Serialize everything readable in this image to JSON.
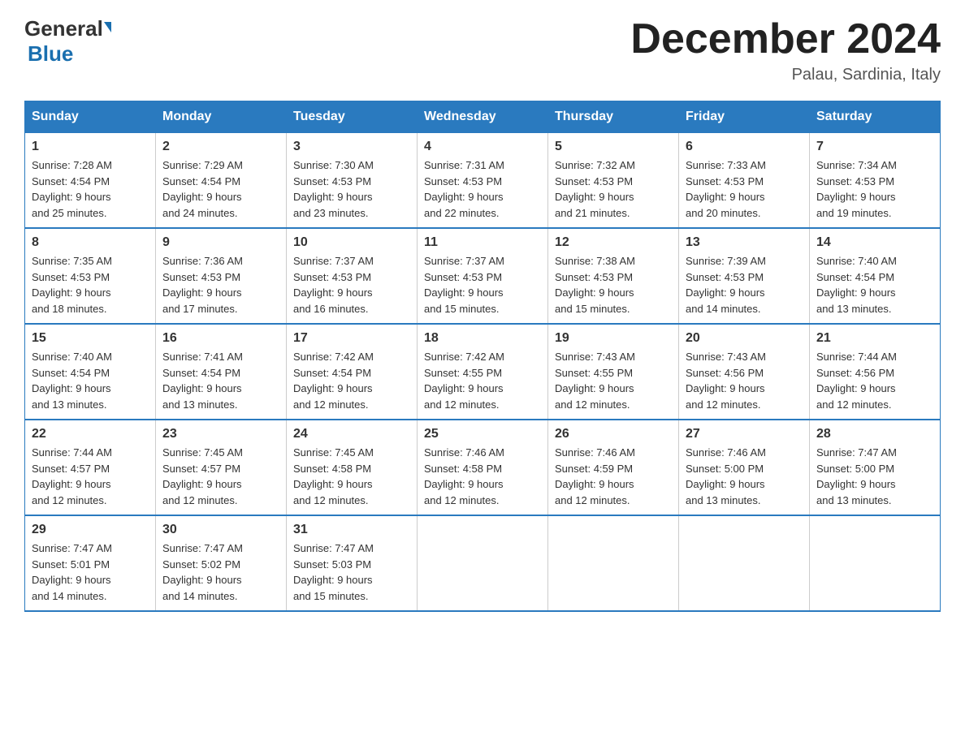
{
  "logo": {
    "general": "General",
    "triangle": "",
    "blue": "Blue"
  },
  "header": {
    "title": "December 2024",
    "location": "Palau, Sardinia, Italy"
  },
  "weekdays": [
    "Sunday",
    "Monday",
    "Tuesday",
    "Wednesday",
    "Thursday",
    "Friday",
    "Saturday"
  ],
  "weeks": [
    [
      {
        "day": "1",
        "sunrise": "7:28 AM",
        "sunset": "4:54 PM",
        "daylight": "9 hours and 25 minutes."
      },
      {
        "day": "2",
        "sunrise": "7:29 AM",
        "sunset": "4:54 PM",
        "daylight": "9 hours and 24 minutes."
      },
      {
        "day": "3",
        "sunrise": "7:30 AM",
        "sunset": "4:53 PM",
        "daylight": "9 hours and 23 minutes."
      },
      {
        "day": "4",
        "sunrise": "7:31 AM",
        "sunset": "4:53 PM",
        "daylight": "9 hours and 22 minutes."
      },
      {
        "day": "5",
        "sunrise": "7:32 AM",
        "sunset": "4:53 PM",
        "daylight": "9 hours and 21 minutes."
      },
      {
        "day": "6",
        "sunrise": "7:33 AM",
        "sunset": "4:53 PM",
        "daylight": "9 hours and 20 minutes."
      },
      {
        "day": "7",
        "sunrise": "7:34 AM",
        "sunset": "4:53 PM",
        "daylight": "9 hours and 19 minutes."
      }
    ],
    [
      {
        "day": "8",
        "sunrise": "7:35 AM",
        "sunset": "4:53 PM",
        "daylight": "9 hours and 18 minutes."
      },
      {
        "day": "9",
        "sunrise": "7:36 AM",
        "sunset": "4:53 PM",
        "daylight": "9 hours and 17 minutes."
      },
      {
        "day": "10",
        "sunrise": "7:37 AM",
        "sunset": "4:53 PM",
        "daylight": "9 hours and 16 minutes."
      },
      {
        "day": "11",
        "sunrise": "7:37 AM",
        "sunset": "4:53 PM",
        "daylight": "9 hours and 15 minutes."
      },
      {
        "day": "12",
        "sunrise": "7:38 AM",
        "sunset": "4:53 PM",
        "daylight": "9 hours and 15 minutes."
      },
      {
        "day": "13",
        "sunrise": "7:39 AM",
        "sunset": "4:53 PM",
        "daylight": "9 hours and 14 minutes."
      },
      {
        "day": "14",
        "sunrise": "7:40 AM",
        "sunset": "4:54 PM",
        "daylight": "9 hours and 13 minutes."
      }
    ],
    [
      {
        "day": "15",
        "sunrise": "7:40 AM",
        "sunset": "4:54 PM",
        "daylight": "9 hours and 13 minutes."
      },
      {
        "day": "16",
        "sunrise": "7:41 AM",
        "sunset": "4:54 PM",
        "daylight": "9 hours and 13 minutes."
      },
      {
        "day": "17",
        "sunrise": "7:42 AM",
        "sunset": "4:54 PM",
        "daylight": "9 hours and 12 minutes."
      },
      {
        "day": "18",
        "sunrise": "7:42 AM",
        "sunset": "4:55 PM",
        "daylight": "9 hours and 12 minutes."
      },
      {
        "day": "19",
        "sunrise": "7:43 AM",
        "sunset": "4:55 PM",
        "daylight": "9 hours and 12 minutes."
      },
      {
        "day": "20",
        "sunrise": "7:43 AM",
        "sunset": "4:56 PM",
        "daylight": "9 hours and 12 minutes."
      },
      {
        "day": "21",
        "sunrise": "7:44 AM",
        "sunset": "4:56 PM",
        "daylight": "9 hours and 12 minutes."
      }
    ],
    [
      {
        "day": "22",
        "sunrise": "7:44 AM",
        "sunset": "4:57 PM",
        "daylight": "9 hours and 12 minutes."
      },
      {
        "day": "23",
        "sunrise": "7:45 AM",
        "sunset": "4:57 PM",
        "daylight": "9 hours and 12 minutes."
      },
      {
        "day": "24",
        "sunrise": "7:45 AM",
        "sunset": "4:58 PM",
        "daylight": "9 hours and 12 minutes."
      },
      {
        "day": "25",
        "sunrise": "7:46 AM",
        "sunset": "4:58 PM",
        "daylight": "9 hours and 12 minutes."
      },
      {
        "day": "26",
        "sunrise": "7:46 AM",
        "sunset": "4:59 PM",
        "daylight": "9 hours and 12 minutes."
      },
      {
        "day": "27",
        "sunrise": "7:46 AM",
        "sunset": "5:00 PM",
        "daylight": "9 hours and 13 minutes."
      },
      {
        "day": "28",
        "sunrise": "7:47 AM",
        "sunset": "5:00 PM",
        "daylight": "9 hours and 13 minutes."
      }
    ],
    [
      {
        "day": "29",
        "sunrise": "7:47 AM",
        "sunset": "5:01 PM",
        "daylight": "9 hours and 14 minutes."
      },
      {
        "day": "30",
        "sunrise": "7:47 AM",
        "sunset": "5:02 PM",
        "daylight": "9 hours and 14 minutes."
      },
      {
        "day": "31",
        "sunrise": "7:47 AM",
        "sunset": "5:03 PM",
        "daylight": "9 hours and 15 minutes."
      },
      null,
      null,
      null,
      null
    ]
  ],
  "labels": {
    "sunrise": "Sunrise:",
    "sunset": "Sunset:",
    "daylight": "Daylight:"
  }
}
